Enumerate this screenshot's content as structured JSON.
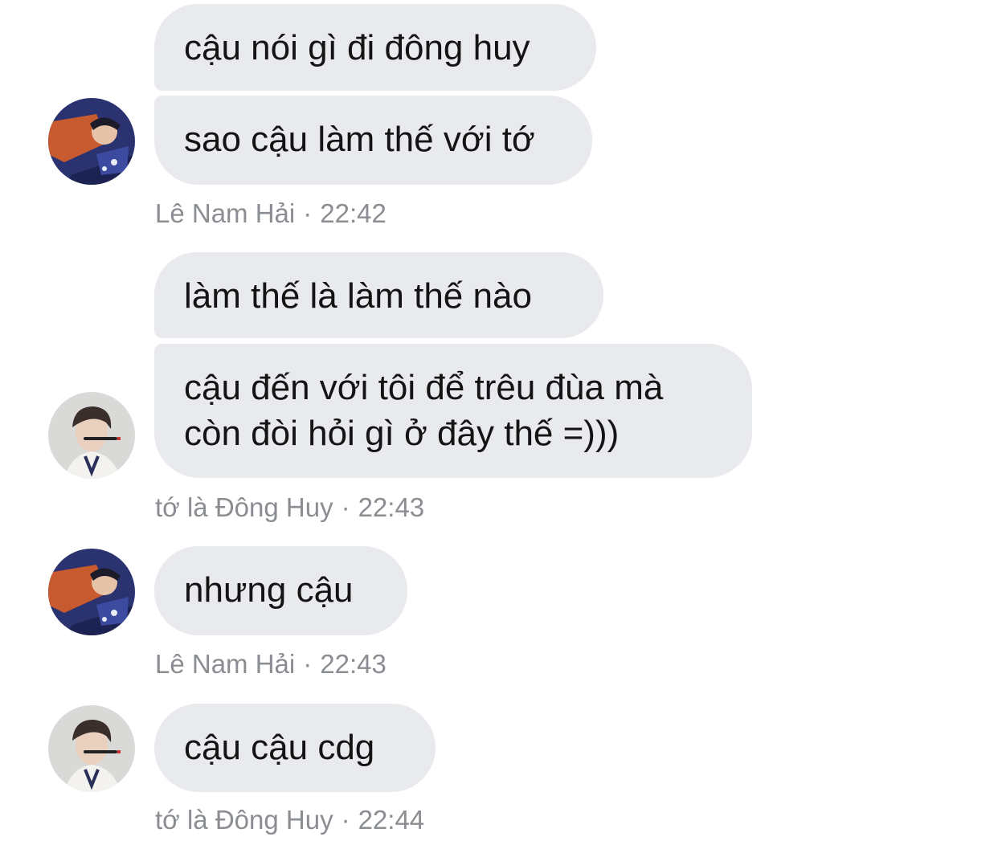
{
  "conversation": {
    "messages": [
      {
        "text": "cậu nói gì đi đông huy"
      },
      {
        "text": "sao cậu làm thế với tớ"
      },
      {
        "text": "làm thế là làm thế nào"
      },
      {
        "text": "cậu đến với tôi để trêu đùa mà\ncòn đòi hỏi gì ở đây thế =)))"
      },
      {
        "text": "nhưng cậu"
      },
      {
        "text": "cậu cậu cdg"
      }
    ],
    "groups": [
      {
        "sender": "Lê Nam Hải",
        "separator": "·",
        "time": "22:42"
      },
      {
        "sender": "tớ là Đông Huy",
        "separator": "·",
        "time": "22:43"
      },
      {
        "sender": "Lê Nam Hải",
        "separator": "·",
        "time": "22:43"
      },
      {
        "sender": "tớ là Đông Huy",
        "separator": "·",
        "time": "22:44"
      }
    ]
  },
  "avatars": {
    "nam_hai": {
      "icon": "profile-photo-icon",
      "colors": [
        "#2b3270",
        "#c75a2e",
        "#e8ecf5"
      ]
    },
    "dong_huy": {
      "icon": "profile-photo-icon",
      "colors": [
        "#d9d9d7",
        "#3a2f2a",
        "#f4f2ee"
      ]
    }
  },
  "colors": {
    "bubble_bg": "#e9eaee",
    "message_text": "#141414",
    "meta_text": "#8a8d91"
  }
}
